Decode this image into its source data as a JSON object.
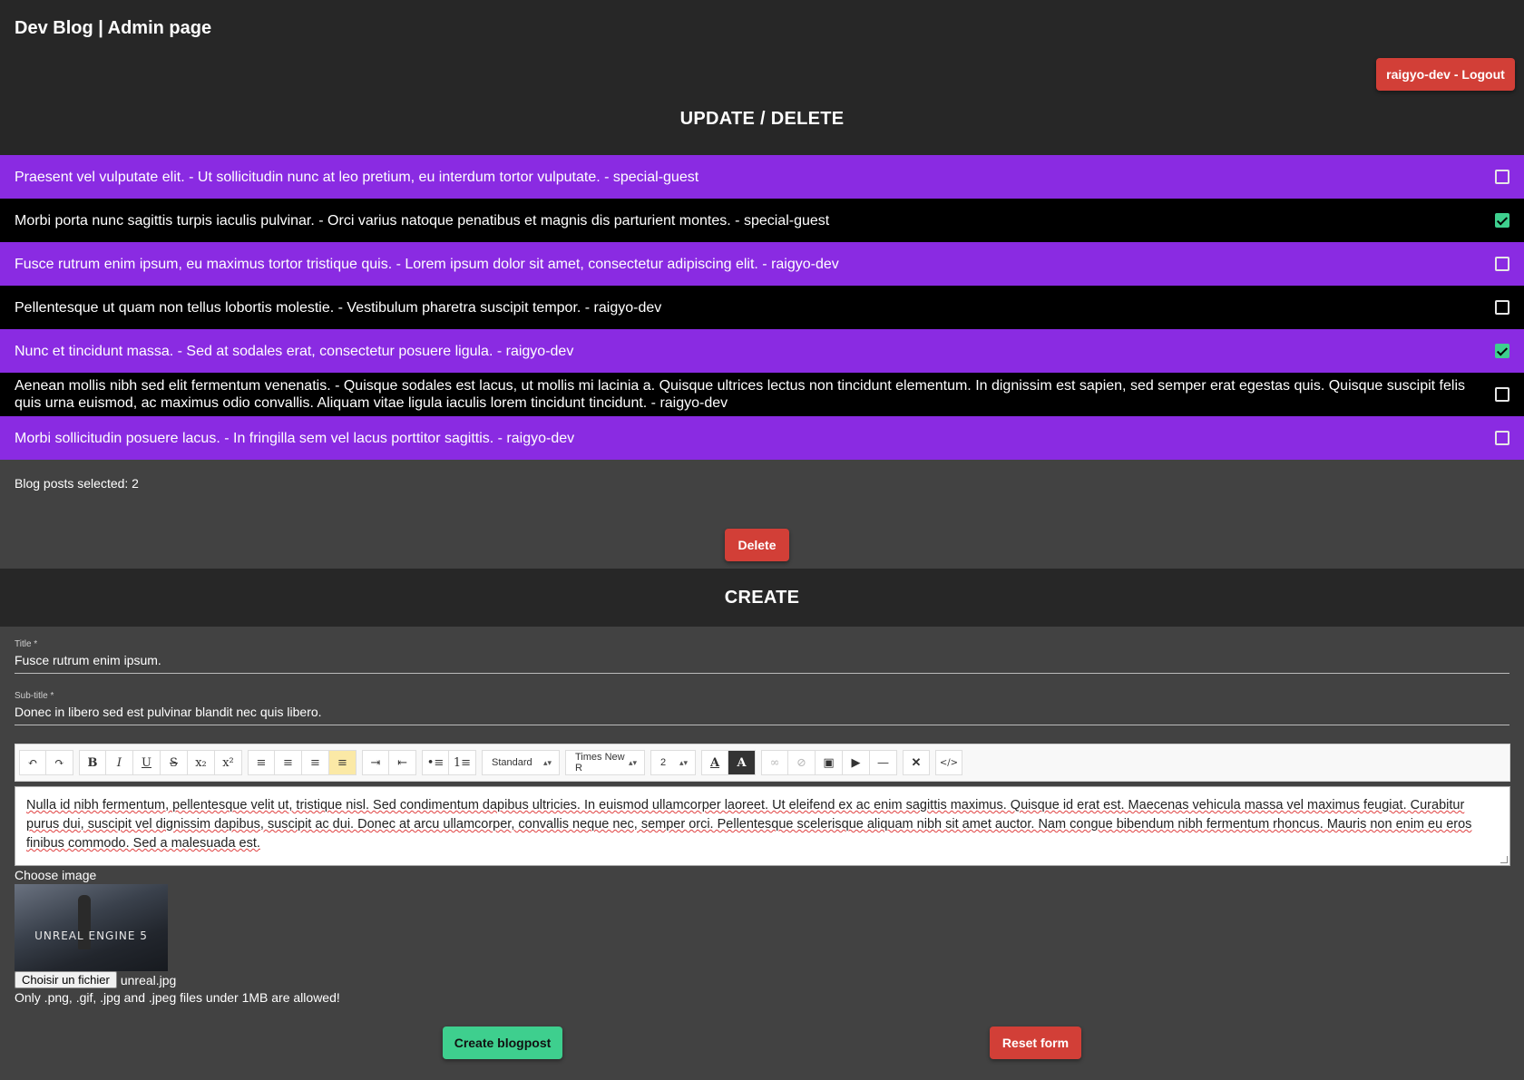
{
  "header": {
    "title": "Dev Blog | Admin page",
    "logout_label": "raigyo-dev - Logout"
  },
  "update_delete": {
    "title": "UPDATE / DELETE",
    "posts": [
      {
        "text": "Praesent vel vulputate elit. - Ut sollicitudin nunc at leo pretium, eu interdum tortor vulputate. - special-guest",
        "checked": false
      },
      {
        "text": "Morbi porta nunc sagittis turpis iaculis pulvinar. - Orci varius natoque penatibus et magnis dis parturient montes. - special-guest",
        "checked": true
      },
      {
        "text": "Fusce rutrum enim ipsum, eu maximus tortor tristique quis. - Lorem ipsum dolor sit amet, consectetur adipiscing elit. - raigyo-dev",
        "checked": false
      },
      {
        "text": "Pellentesque ut quam non tellus lobortis molestie. - Vestibulum pharetra suscipit tempor. - raigyo-dev",
        "checked": false
      },
      {
        "text": "Nunc et tincidunt massa. - Sed at sodales erat, consectetur posuere ligula. - raigyo-dev",
        "checked": true
      },
      {
        "text": "Aenean mollis nibh sed elit fermentum venenatis. - Quisque sodales est lacus, ut mollis mi lacinia a. Quisque ultrices lectus non tincidunt elementum. In dignissim est sapien, sed semper erat egestas quis. Quisque suscipit felis quis urna euismod, ac maximus odio convallis. Aliquam vitae ligula iaculis lorem tincidunt tincidunt. - raigyo-dev",
        "checked": false
      },
      {
        "text": "Morbi sollicitudin posuere lacus. - In fringilla sem vel lacus porttitor sagittis. - raigyo-dev",
        "checked": false
      }
    ],
    "selected_count_text": "Blog posts selected: 2",
    "delete_label": "Delete"
  },
  "create": {
    "title": "CREATE",
    "title_field": {
      "label": "Title *",
      "value": "Fusce rutrum enim ipsum."
    },
    "subtitle_field": {
      "label": "Sub-title *",
      "value": "Donec in libero sed est pulvinar blandit nec quis libero."
    },
    "toolbar": {
      "format_select": "Standard",
      "font_select": "Times New R",
      "size_select": "2"
    },
    "editor_text": "Nulla id nibh fermentum, pellentesque velit ut, tristique nisl. Sed condimentum dapibus ultricies. In euismod ullamcorper laoreet. Ut eleifend ex ac enim sagittis maximus. Quisque id erat est. Maecenas vehicula massa vel maximus feugiat. Curabitur purus dui, suscipit vel dignissim dapibus, suscipit ac dui. Donec at arcu ullamcorper, convallis neque nec, semper orci. Pellentesque scelerisque aliquam nibh sit amet auctor. Nam congue bibendum nibh fermentum rhoncus. Mauris non enim eu eros finibus commodo. Sed a malesuada est.",
    "choose_image_label": "Choose image",
    "thumbnail_text": "UNREAL ENGINE 5",
    "file_button_label": "Choisir un fichier",
    "file_name": "unreal.jpg",
    "file_note": "Only .png, .gif, .jpg and .jpeg files under 1MB are allowed!",
    "create_label": "Create blogpost",
    "reset_label": "Reset form"
  },
  "colors": {
    "accent_purple": "#8a2be2",
    "danger_red": "#d23f37",
    "success_green": "#3ecf8e"
  }
}
